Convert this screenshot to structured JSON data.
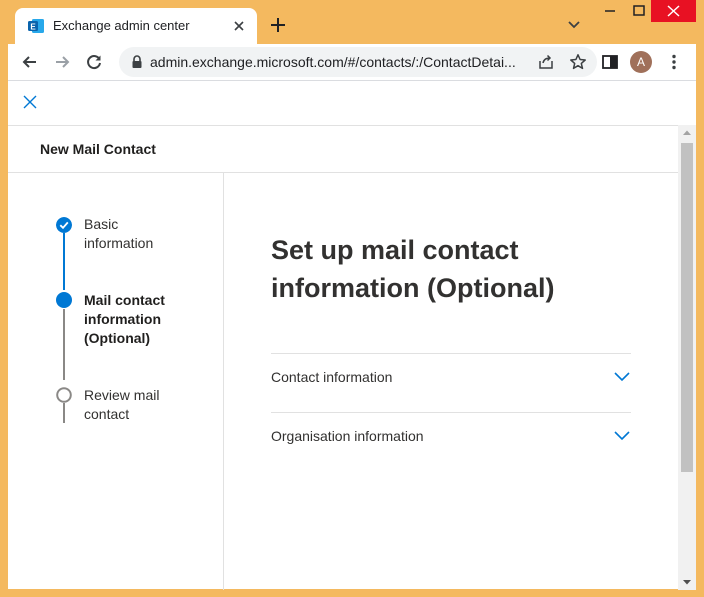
{
  "browser": {
    "tab_title": "Exchange admin center",
    "favicon_letter": "E",
    "url": "admin.exchange.microsoft.com/#/contacts/:/ContactDetai...",
    "profile_initial": "A"
  },
  "panel": {
    "title": "New Mail Contact"
  },
  "steps": [
    {
      "label_line1": "Basic",
      "label_line2": "information",
      "label_line3": "",
      "state": "completed"
    },
    {
      "label_line1": "Mail contact",
      "label_line2": "information",
      "label_line3": "(Optional)",
      "state": "current"
    },
    {
      "label_line1": "Review mail",
      "label_line2": "contact",
      "label_line3": "",
      "state": "pending"
    }
  ],
  "main": {
    "heading_line1": "Set up mail contact",
    "heading_line2": "information (Optional)",
    "sections": [
      {
        "label": "Contact information",
        "icon": "chevron-down-icon"
      },
      {
        "label": "Organisation information",
        "icon": "chevron-down-icon"
      }
    ]
  },
  "colors": {
    "frame": "#f4b95f",
    "accent": "#0078d4",
    "close": "#e81123",
    "pending_step": "#8a8886"
  }
}
